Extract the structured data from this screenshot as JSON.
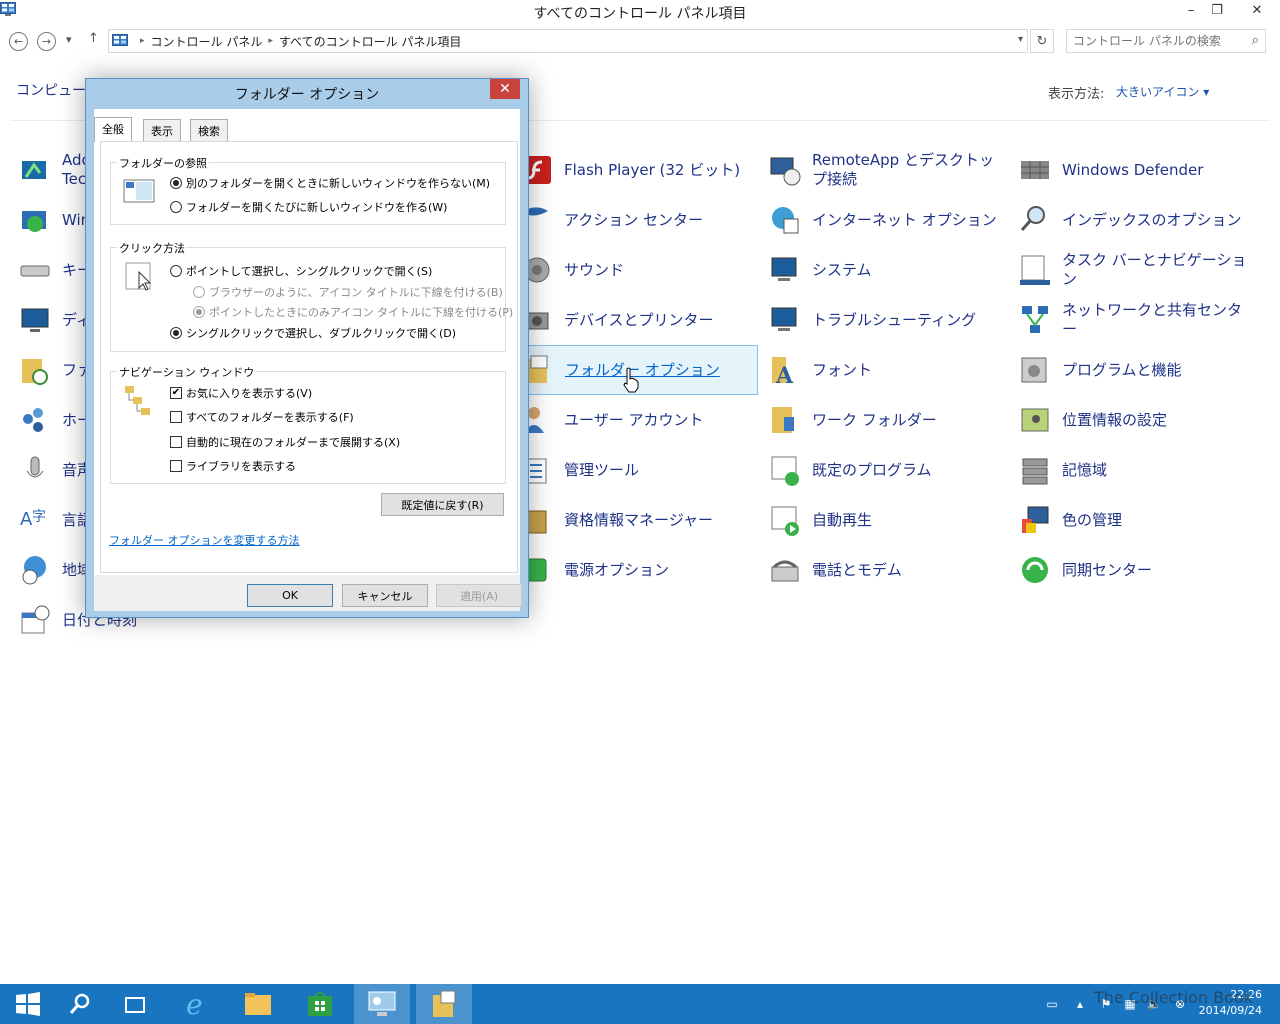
{
  "window": {
    "title": "すべてのコントロール パネル項目",
    "minimize": "–",
    "restore": "❐",
    "close": "✕"
  },
  "address_bar": {
    "crumbs": [
      "コントロール パネル",
      "すべてのコントロール パネル項目"
    ],
    "search_placeholder": "コントロール パネルの検索"
  },
  "main": {
    "heading": "コンピューターの設定を調整します",
    "view_by_label": "表示方法:",
    "view_by_value": "大きいアイコン ▾",
    "items_col1_visible": [
      "Ado",
      "Tec",
      "Win",
      "キー",
      "ディ",
      "ファ",
      "ホー",
      "音声",
      "言語",
      "地域",
      "日付と時刻"
    ],
    "items": [
      {
        "label": "Flash Player (32 ビット)",
        "icon": "flash-icon"
      },
      {
        "label": "RemoteApp とデスクトップ接続",
        "icon": "remoteapp-icon"
      },
      {
        "label": "Windows Defender",
        "icon": "defender-icon"
      },
      {
        "label": "アクション センター",
        "icon": "action-center-icon"
      },
      {
        "label": "インターネット オプション",
        "icon": "internet-options-icon"
      },
      {
        "label": "インデックスのオプション",
        "icon": "indexing-icon"
      },
      {
        "label": "サウンド",
        "icon": "sound-icon"
      },
      {
        "label": "システム",
        "icon": "system-icon"
      },
      {
        "label": "タスク バーとナビゲーション",
        "icon": "taskbar-icon"
      },
      {
        "label": "デバイスとプリンター",
        "icon": "devices-icon"
      },
      {
        "label": "トラブルシューティング",
        "icon": "troubleshoot-icon"
      },
      {
        "label": "ネットワークと共有センター",
        "icon": "network-icon"
      },
      {
        "label": "フォルダー オプション",
        "icon": "folder-options-icon"
      },
      {
        "label": "フォント",
        "icon": "font-icon"
      },
      {
        "label": "プログラムと機能",
        "icon": "programs-icon"
      },
      {
        "label": "ユーザー アカウント",
        "icon": "user-accounts-icon"
      },
      {
        "label": "ワーク フォルダー",
        "icon": "work-folders-icon"
      },
      {
        "label": "位置情報の設定",
        "icon": "location-icon"
      },
      {
        "label": "管理ツール",
        "icon": "admin-tools-icon"
      },
      {
        "label": "既定のプログラム",
        "icon": "default-programs-icon"
      },
      {
        "label": "記憶域",
        "icon": "storage-icon"
      },
      {
        "label": "資格情報マネージャー",
        "icon": "credential-icon"
      },
      {
        "label": "自動再生",
        "icon": "autoplay-icon"
      },
      {
        "label": "色の管理",
        "icon": "color-icon"
      },
      {
        "label": "電源オプション",
        "icon": "power-icon"
      },
      {
        "label": "電話とモデム",
        "icon": "phone-icon"
      },
      {
        "label": "同期センター",
        "icon": "sync-icon"
      }
    ]
  },
  "dialog": {
    "title": "フォルダー オプション",
    "tabs": [
      "全般",
      "表示",
      "検索"
    ],
    "group_browse": {
      "title": "フォルダーの参照",
      "opt1": "別のフォルダーを開くときに新しいウィンドウを作らない(M)",
      "opt2": "フォルダーを開くたびに新しいウィンドウを作る(W)"
    },
    "group_click": {
      "title": "クリック方法",
      "opt1": "ポイントして選択し、シングルクリックで開く(S)",
      "sub1": "ブラウザーのように、アイコン タイトルに下線を付ける(B)",
      "sub2": "ポイントしたときにのみアイコン タイトルに下線を付ける(P)",
      "opt2": "シングルクリックで選択し、ダブルクリックで開く(D)"
    },
    "group_nav": {
      "title": "ナビゲーション ウィンドウ",
      "chk1": "お気に入りを表示する(V)",
      "chk2": "すべてのフォルダーを表示する(F)",
      "chk3": "自動的に現在のフォルダーまで展開する(X)",
      "chk4": "ライブラリを表示する"
    },
    "restore_defaults": "既定値に戻す(R)",
    "help_link": "フォルダー オプションを変更する方法",
    "ok": "OK",
    "cancel": "キャンセル",
    "apply": "適用(A)"
  },
  "taskbar": {
    "time": "22:26",
    "date": "2014/09/24"
  },
  "watermark": "The Collection Book",
  "colors": {
    "taskbar": "#1975c0",
    "link": "#1e3287",
    "highlight_bg": "#e5f3fb",
    "dialog_frame": "#a9cde9"
  }
}
